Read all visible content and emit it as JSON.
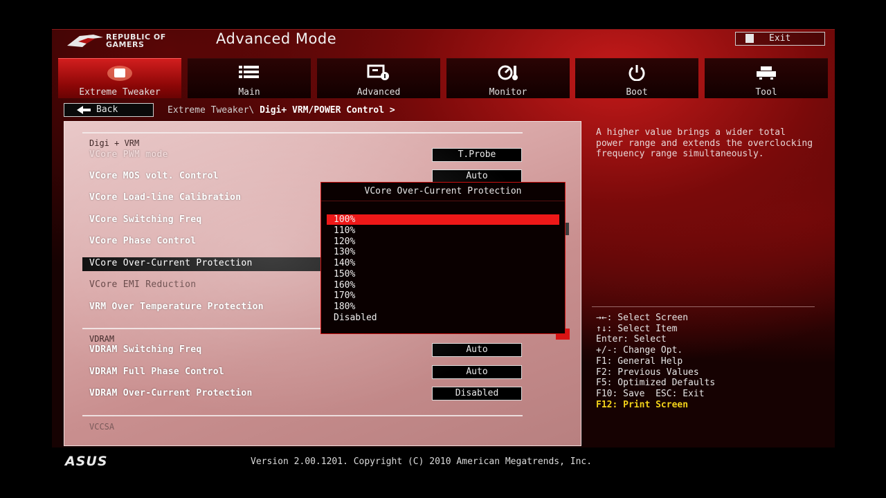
{
  "header": {
    "brand": [
      "REPUBLIC OF",
      "GAMERS"
    ],
    "title": "Advanced Mode",
    "exit_label": "Exit"
  },
  "tabs": [
    {
      "label": "Extreme Tweaker",
      "icon": "extreme-tweaker-icon",
      "active": true
    },
    {
      "label": "Main",
      "icon": "list-icon",
      "active": false
    },
    {
      "label": "Advanced",
      "icon": "advanced-settings-icon",
      "active": false
    },
    {
      "label": "Monitor",
      "icon": "monitor-gauge-icon",
      "active": false
    },
    {
      "label": "Boot",
      "icon": "power-icon",
      "active": false
    },
    {
      "label": "Tool",
      "icon": "tool-icon",
      "active": false
    }
  ],
  "nav": {
    "back_label": "Back",
    "breadcrumb_prefix": "Extreme Tweaker\\ ",
    "breadcrumb_current": "Digi+ VRM/POWER Control >"
  },
  "settings": {
    "section_vrm": "Digi + VRM",
    "rows": [
      {
        "label": "VCore PWM mode",
        "value": "T.Probe"
      },
      {
        "label": "VCore MOS volt. Control",
        "value": "Auto"
      },
      {
        "label": "VCore Load-line Calibration"
      },
      {
        "label": "VCore Switching Freq"
      },
      {
        "label": "VCore Phase Control"
      },
      {
        "label": "VCore Over-Current Protection",
        "selected": true
      },
      {
        "label": "VCore EMI Reduction"
      },
      {
        "label": "VRM Over Temperature Protection"
      }
    ],
    "section_vdram": "VDRAM",
    "vdram_rows": [
      {
        "label": "VDRAM Switching Freq",
        "value": "Auto"
      },
      {
        "label": "VDRAM Full Phase Control",
        "value": "Auto"
      },
      {
        "label": "VDRAM Over-Current Protection",
        "value": "Disabled"
      }
    ],
    "section_vccsa": "VCCSA"
  },
  "popup": {
    "title": "VCore Over-Current Protection",
    "options": [
      "100%",
      "110%",
      "120%",
      "130%",
      "140%",
      "150%",
      "160%",
      "170%",
      "180%",
      "Disabled"
    ],
    "selected_index": 0
  },
  "help": {
    "text": "A higher value brings a wider total power range and extends the overclocking frequency range simultaneously.",
    "keys": [
      "→←: Select Screen",
      "↑↓: Select Item",
      "Enter: Select",
      "+/-: Change Opt.",
      "F1: General Help",
      "F2: Previous Values",
      "F5: Optimized Defaults",
      "F10: Save  ESC: Exit"
    ],
    "highlight_key": "F12: Print Screen"
  },
  "footer": {
    "brand": "ASUS",
    "version": "Version 2.00.1201. Copyright (C) 2010 American Megatrends, Inc."
  },
  "colors": {
    "accent_red": "#ee1818",
    "highlight_yellow": "#f2d21a"
  }
}
